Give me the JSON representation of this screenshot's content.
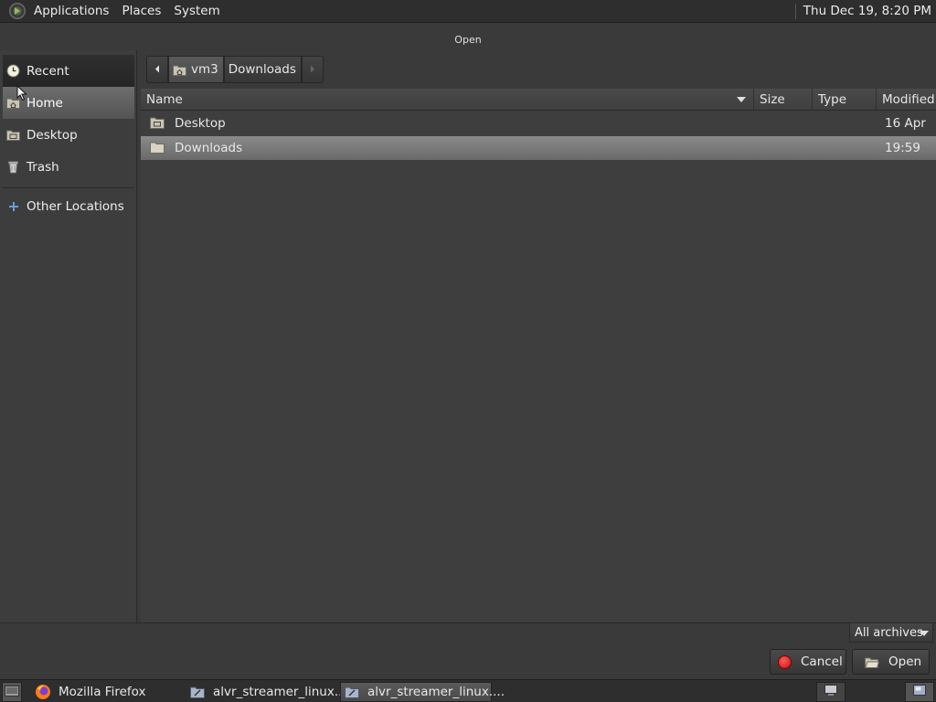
{
  "top_panel": {
    "menus": [
      "Applications",
      "Places",
      "System"
    ],
    "clock": "Thu Dec 19,  8:20 PM"
  },
  "dialog": {
    "title": "Open"
  },
  "sidebar": {
    "items": [
      {
        "label": "Recent",
        "icon": "recent-icon"
      },
      {
        "label": "Home",
        "icon": "home-folder-icon"
      },
      {
        "label": "Desktop",
        "icon": "desktop-folder-icon"
      },
      {
        "label": "Trash",
        "icon": "trash-icon"
      },
      {
        "label": "Other Locations",
        "icon": "plus-icon"
      }
    ]
  },
  "pathbar": {
    "segments": [
      "vm3",
      "Downloads"
    ]
  },
  "file_list": {
    "columns": [
      "Name",
      "Size",
      "Type",
      "Modified"
    ],
    "rows": [
      {
        "name": "Desktop",
        "size": "",
        "type": "",
        "modified": "16 Apr",
        "selected": false
      },
      {
        "name": "Downloads",
        "size": "",
        "type": "",
        "modified": "19:59",
        "selected": true
      }
    ]
  },
  "filter": {
    "selected": "All archives"
  },
  "buttons": {
    "cancel": "Cancel",
    "open": "Open"
  },
  "taskbar": {
    "tasks": [
      {
        "label": "Mozilla Firefox",
        "icon": "firefox-icon",
        "active": false
      },
      {
        "label": "alvr_streamer_linux....",
        "icon": "file-manager-icon",
        "active": false
      },
      {
        "label": "alvr_streamer_linux....",
        "icon": "file-manager-icon",
        "active": true
      }
    ]
  },
  "colors": {
    "background": "#3a3a3a",
    "selection": "#7a7a7a",
    "cancel_red": "#d81c1c"
  }
}
